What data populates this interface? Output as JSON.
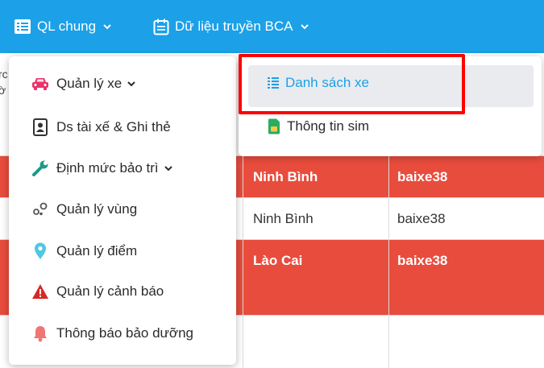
{
  "topbar": {
    "menus": [
      {
        "label": "QL chung",
        "icon": "list-icon"
      },
      {
        "label": "Dữ liệu truyền BCA",
        "icon": "calendar-icon"
      }
    ]
  },
  "table": {
    "header_fragment_1": "rc",
    "header_fragment_2": "ờ",
    "rows": [
      {
        "province": "Ninh Bình",
        "user": "baixe38"
      },
      {
        "province": "Ninh Bình",
        "user": "baixe38"
      },
      {
        "province": "Lào Cai",
        "user": "baixe38"
      }
    ]
  },
  "menu": {
    "items": [
      {
        "label": "Quản lý xe",
        "icon": "car-icon"
      },
      {
        "label": "Ds tài xế & Ghi thẻ",
        "icon": "id-card-icon"
      },
      {
        "label": "Định mức bảo trì",
        "icon": "wrench-icon"
      },
      {
        "label": "Quản lý vùng",
        "icon": "region-icon"
      },
      {
        "label": "Quản lý điểm",
        "icon": "map-marker-icon"
      },
      {
        "label": "Quản lý cảnh báo",
        "icon": "warning-icon"
      },
      {
        "label": "Thông báo bảo dưỡng",
        "icon": "bell-icon"
      }
    ]
  },
  "submenu": {
    "items": [
      {
        "label": "Danh sách xe",
        "icon": "list-icon"
      },
      {
        "label": "Thông tin sim",
        "icon": "sim-card-icon"
      }
    ]
  },
  "colors": {
    "topbar": "#1ca0e8",
    "row_red": "#e84c3d",
    "car": "#e8336d",
    "wrench": "#1a9a8a",
    "marker": "#4ec8e4",
    "warning": "#d62828",
    "bell": "#f07575",
    "sim": "#27ae60",
    "highlight": "#ff0000"
  }
}
